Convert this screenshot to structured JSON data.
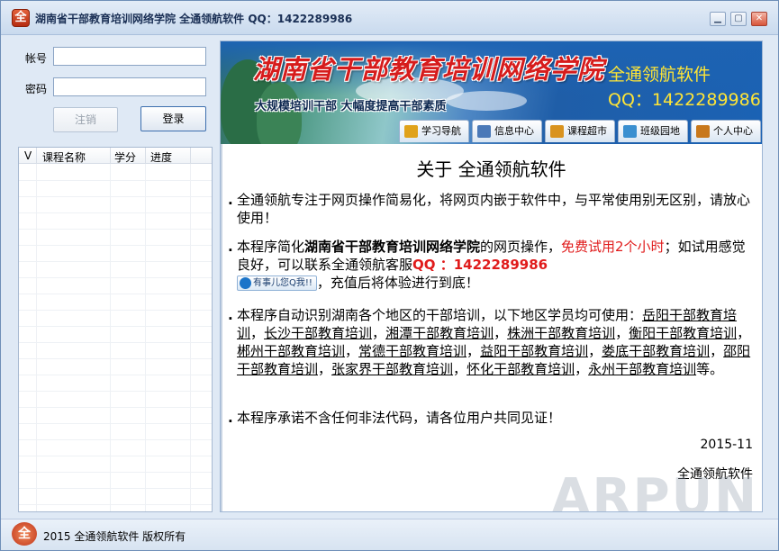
{
  "window": {
    "title": "湖南省干部教育培训网络学院 全通领航软件 QQ：1422289986",
    "app_icon_glyph": "全",
    "controls": {
      "minimize": "▁",
      "maximize": "▢",
      "close": "✕"
    }
  },
  "login": {
    "account_label": "帐号",
    "password_label": "密码",
    "account_value": "",
    "password_value": "",
    "logout_button": "注销",
    "login_button": "登录"
  },
  "course_list": {
    "columns": [
      "V",
      "课程名称",
      "学分",
      "进度"
    ],
    "rows": []
  },
  "banner": {
    "title": "湖南省干部教育培训网络学院",
    "slogan": "大规模培训干部  大幅度提高干部素质",
    "brand": "全通领航软件",
    "qq": "QQ：1422289986"
  },
  "nav_tabs": [
    {
      "label": "学习导航",
      "icon": "compass-icon",
      "color": "#e0a21a"
    },
    {
      "label": "信息中心",
      "icon": "info-icon",
      "color": "#4a79b8"
    },
    {
      "label": "课程超市",
      "icon": "cart-icon",
      "color": "#d9931f"
    },
    {
      "label": "班级园地",
      "icon": "people-icon",
      "color": "#3a8fd0"
    },
    {
      "label": "个人中心",
      "icon": "person-icon",
      "color": "#c8781c"
    }
  ],
  "about": {
    "title": "关于  全通领航软件",
    "p1": "全通领航专注于网页操作简易化，将网页内嵌于软件中，与平常使用别无区别，请放心使用！",
    "p2_a": "本程序简化",
    "p2_site": "湖南省干部教育培训网络学院",
    "p2_b": "的网页操作，",
    "p2_trial": "免费试用2个小时",
    "p2_c": "；如试用感觉良好，可以联系全通领航客服",
    "p2_qq": "QQ ：1422289986",
    "qq_chip": "有事儿您Q我!!",
    "p2_d": "，充值后将体验进行到底！",
    "p3_intro": "本程序自动识别湖南各个地区的干部培训，以下地区学员均可使用：",
    "regions": [
      "岳阳干部教育培训",
      "长沙干部教育培训",
      "湘潭干部教育培训",
      "株洲干部教育培训",
      "衡阳干部教育培训",
      "郴州干部教育培训",
      "常德干部教育培训",
      "益阳干部教育培训",
      "娄底干部教育培训",
      "邵阳干部教育培训",
      "张家界干部教育培训",
      "怀化干部教育培训",
      "永州干部教育培训"
    ],
    "region_sep": "，",
    "p3_end": "等。",
    "p4": "本程序承诺不含任何非法代码，请各位用户共同见证！",
    "date": "2015-11",
    "signature": "全通领航软件",
    "watermark": "ARPUN"
  },
  "status": {
    "icon_glyph": "全",
    "text": "2015 全通领航软件 版权所有"
  }
}
